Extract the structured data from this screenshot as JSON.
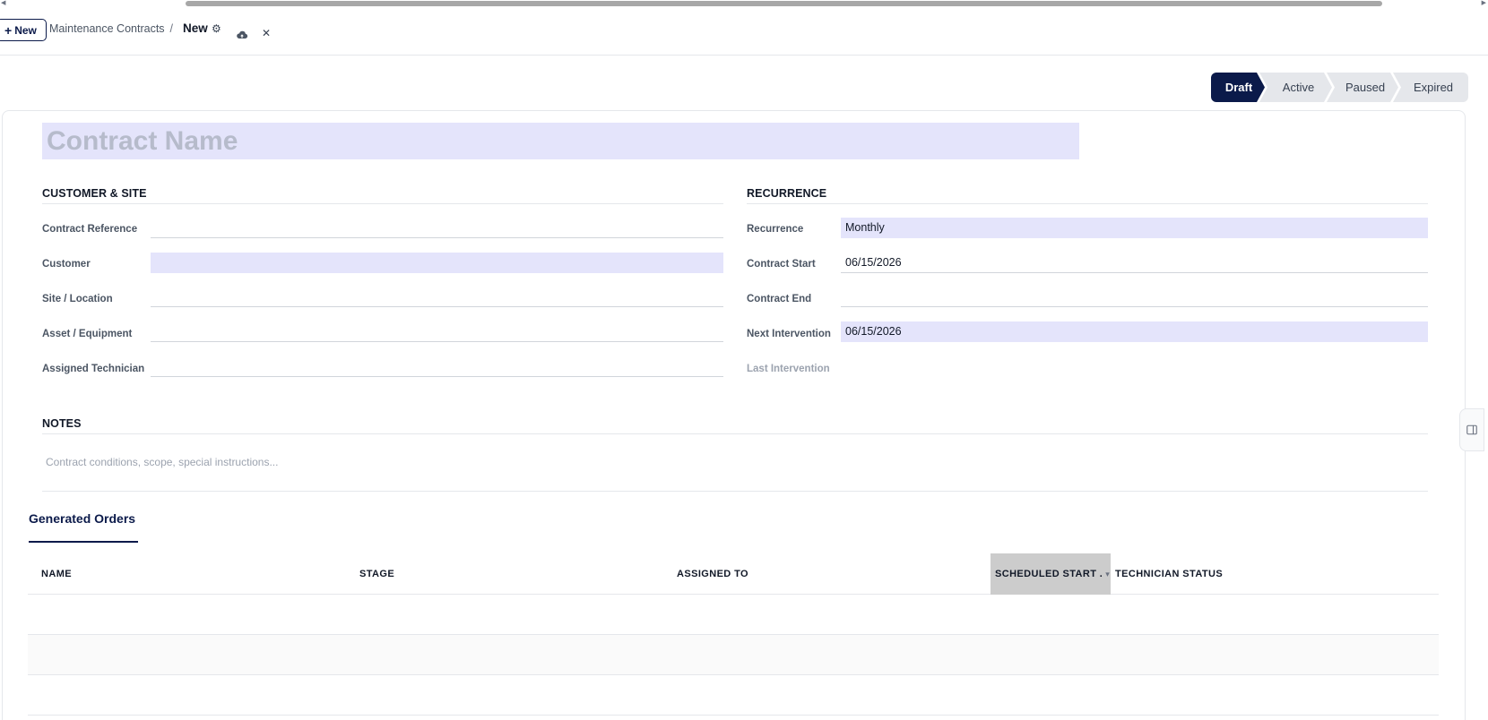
{
  "control_panel": {
    "new_button_label": "New",
    "breadcrumb_parent": "Maintenance Contracts",
    "breadcrumb_separator": "/",
    "current_record": "New"
  },
  "statusbar": {
    "stages": [
      "Draft",
      "Active",
      "Paused",
      "Expired"
    ],
    "active_stage": "Draft"
  },
  "form": {
    "name_placeholder": "Contract Name",
    "customer_site": {
      "title": "CUSTOMER & SITE",
      "contract_reference_label": "Contract Reference",
      "contract_reference_value": "",
      "customer_label": "Customer",
      "customer_value": "",
      "site_label": "Site / Location",
      "site_value": "",
      "asset_label": "Asset / Equipment",
      "asset_value": "",
      "technician_label": "Assigned Technician",
      "technician_value": ""
    },
    "recurrence": {
      "title": "RECURRENCE",
      "recurrence_label": "Recurrence",
      "recurrence_value": "Monthly",
      "contract_start_label": "Contract Start",
      "contract_start_value": "06/15/2026",
      "contract_end_label": "Contract End",
      "contract_end_value": "",
      "next_intervention_label": "Next Intervention",
      "next_intervention_value": "06/15/2026",
      "last_intervention_label": "Last Intervention"
    },
    "notes": {
      "title": "NOTES",
      "placeholder": "Contract conditions, scope, special instructions..."
    }
  },
  "generated_orders": {
    "tab_label": "Generated Orders",
    "columns": [
      "NAME",
      "STAGE",
      "ASSIGNED TO",
      "SCHEDULED START .",
      "TECHNICIAN STATUS"
    ],
    "rows": []
  },
  "colors": {
    "brand": "#0b1a4a",
    "required_field": "#e4e4fb",
    "sorted_column": "#cccccc"
  },
  "icons": [
    "plus-icon",
    "gear-icon",
    "cloud-upload-icon",
    "close-icon",
    "chevron-down-icon",
    "panel-toggle-icon"
  ]
}
